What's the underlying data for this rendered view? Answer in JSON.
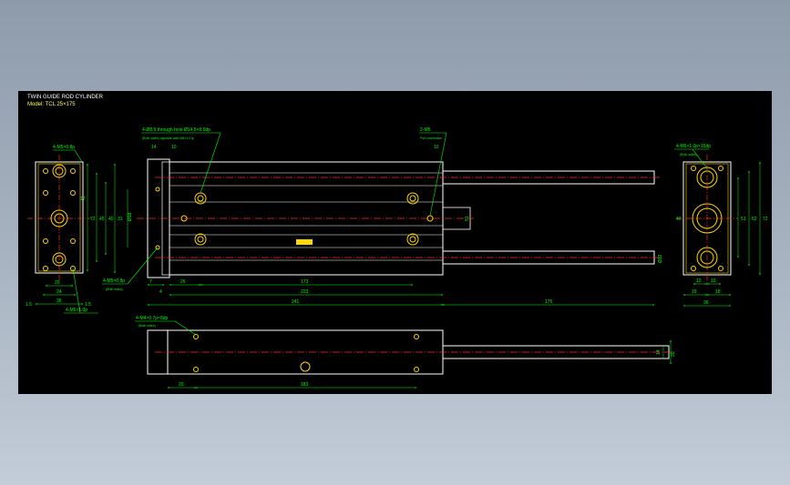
{
  "title": {
    "line1": "TWIN GUIDE ROD CYLINDER",
    "line2": "Model: TCL 25×175"
  },
  "colors": {
    "outline": "#ffffff",
    "dimension": "#00ff00",
    "centerline": "#ff2a2a",
    "port": "#ffd700",
    "background": "#000000"
  },
  "callouts": {
    "counterbore": "4-Ø8.5 through hole Ø14.5×8.5dp",
    "counterbore_sub": "(Both sides) opposite side M8×1.0 tp",
    "port": "2-M5",
    "port_sub": "Port connection",
    "left_top_tap": "4-M5×0.8p",
    "left_bottom_tap": "4-M6×1.0p",
    "side_tap": "4-M5×0.8p",
    "side_tap_sub": "(Both sides)",
    "right_tap": "4-M6×1.0p×15dp",
    "right_tap_sub": "(Both sides)",
    "bottom_tap": "4-M4×0.7p×8dp",
    "bottom_tap_sub": "(Both sides)"
  },
  "dims": {
    "front": {
      "w1": "20",
      "w2": "24",
      "w3": "36",
      "side1": "1.5",
      "side2": "1.5",
      "v1": "17",
      "v2": "31",
      "v3": "40",
      "v4": "45",
      "v5": "72"
    },
    "top": {
      "d14": "14",
      "d10a": "10",
      "d10b": "10",
      "rod_dia": "Ø18",
      "rod_dia2": "Ø12",
      "h51": "51",
      "d7": "7",
      "d4": "4",
      "d26": "26",
      "d173": "173",
      "d223": "223",
      "d241": "241",
      "d175": "175"
    },
    "right": {
      "w12": "12",
      "w19": "19",
      "w10": "10",
      "w18": "18",
      "w36": "36",
      "h51": "51",
      "h62": "62",
      "h72": "72",
      "h40": "40"
    },
    "side": {
      "d20": "20",
      "d183": "183",
      "h14": "14",
      "h30": "30"
    }
  }
}
